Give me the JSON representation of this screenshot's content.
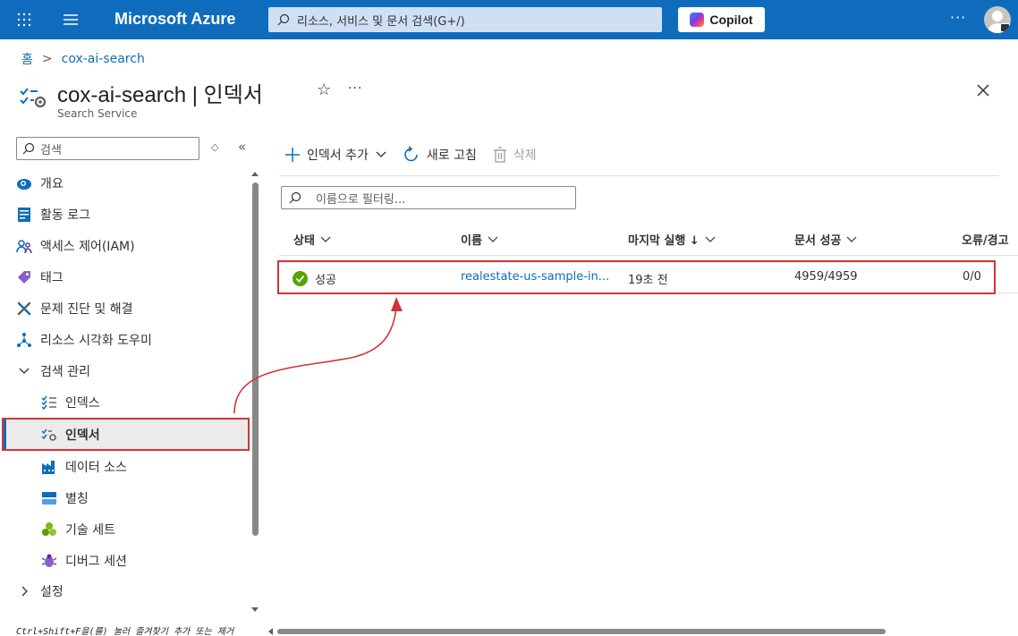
{
  "topbar": {
    "brand": "Microsoft Azure",
    "search_placeholder": "리소스, 서비스 및 문서 검색(G+/)",
    "copilot_label": "Copilot",
    "more": "···"
  },
  "breadcrumb": {
    "home": "홈",
    "current": "cox-ai-search"
  },
  "header": {
    "title": "cox-ai-search | 인덱서",
    "subtitle": "Search Service",
    "more": "···"
  },
  "sidebar": {
    "search_placeholder": "검색",
    "items": [
      {
        "label": "개요"
      },
      {
        "label": "활동 로그"
      },
      {
        "label": "액세스 제어(IAM)"
      },
      {
        "label": "태그"
      },
      {
        "label": "문제 진단 및 해결"
      },
      {
        "label": "리소스 시각화 도우미"
      },
      {
        "label": "검색 관리"
      },
      {
        "label": "인덱스"
      },
      {
        "label": "인덱서"
      },
      {
        "label": "데이터 소스"
      },
      {
        "label": "별칭"
      },
      {
        "label": "기술 세트"
      },
      {
        "label": "디버그 세션"
      },
      {
        "label": "설정"
      }
    ],
    "hint": "Ctrl+Shift+F을(를) 눌러 즐겨찾기 추가 또는 제거"
  },
  "toolbar": {
    "add_label": "인덱서 추가",
    "refresh_label": "새로 고침",
    "delete_label": "삭제"
  },
  "filter": {
    "placeholder": "이름으로 필터링..."
  },
  "table": {
    "columns": [
      "상태",
      "이름",
      "마지막 실행 ↓",
      "문서 성공",
      "오류/경고"
    ],
    "rows": [
      {
        "status": "성공",
        "name": "realestate-us-sample-in...",
        "last_run": "19초 전",
        "docs_succeeded": "4959/4959",
        "errors_warnings": "0/0"
      }
    ]
  },
  "colors": {
    "accent": "#0f6cbd",
    "highlight": "#d13438",
    "success": "#57a300"
  }
}
